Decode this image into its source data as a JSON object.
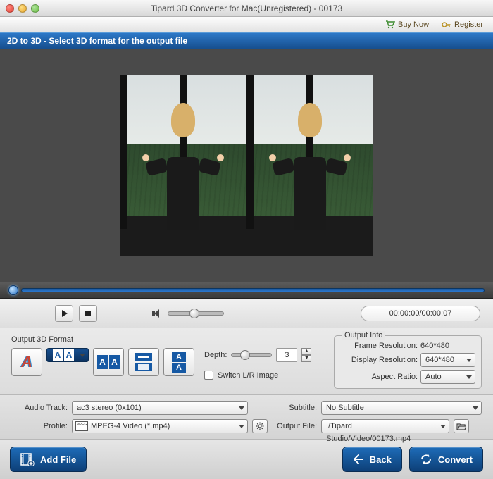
{
  "window": {
    "title": "Tipard 3D Converter for Mac(Unregistered) - 00173"
  },
  "menu": {
    "buy": "Buy Now",
    "register": "Register"
  },
  "bluebar": "2D to 3D - Select 3D format for the output file",
  "playback": {
    "time": "00:00:00/00:00:07",
    "volume_pct": 45,
    "seek_pct": 0
  },
  "format": {
    "section_title": "Output 3D Format",
    "depth_label": "Depth:",
    "depth_value": "3",
    "switch_label": "Switch L/R Image",
    "switch_checked": false
  },
  "output_info": {
    "title": "Output Info",
    "frame_res_label": "Frame Resolution:",
    "frame_res_value": "640*480",
    "display_res_label": "Display Resolution:",
    "display_res_value": "640*480",
    "aspect_label": "Aspect Ratio:",
    "aspect_value": "Auto"
  },
  "fields": {
    "audio_track_label": "Audio Track:",
    "audio_track_value": "ac3 stereo (0x101)",
    "subtitle_label": "Subtitle:",
    "subtitle_value": "No Subtitle",
    "profile_label": "Profile:",
    "profile_value": "MPEG-4 Video (*.mp4)",
    "output_file_label": "Output File:",
    "output_file_value": "./Tipard Studio/Video/00173.mp4"
  },
  "buttons": {
    "add_file": "Add File",
    "back": "Back",
    "convert": "Convert"
  }
}
